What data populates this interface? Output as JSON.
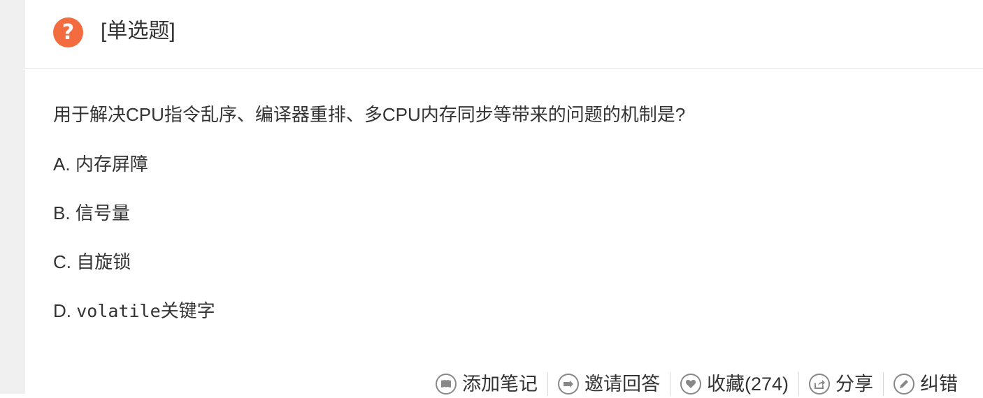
{
  "question": {
    "type_label": "[单选题]",
    "icon": "question-mark-icon",
    "stem": "用于解决CPU指令乱序、编译器重排、多CPU内存同步等带来的问题的机制是?",
    "options": [
      {
        "letter": "A.",
        "text": "内存屏障"
      },
      {
        "letter": "B.",
        "text": "信号量"
      },
      {
        "letter": "C.",
        "text": "自旋锁"
      },
      {
        "letter": "D.",
        "code": "volatile",
        "text": "关键字"
      }
    ]
  },
  "actions": [
    {
      "label": "添加笔记",
      "icon": "book-icon"
    },
    {
      "label": "邀请回答",
      "icon": "invite-icon"
    },
    {
      "label": "收藏(274)",
      "icon": "heart-icon"
    },
    {
      "label": "分享",
      "icon": "share-icon"
    },
    {
      "label": "纠错",
      "icon": "pencil-icon"
    }
  ],
  "colors": {
    "accent": "#f26c3f",
    "text": "#333333",
    "gutter": "#f0f0f0"
  }
}
